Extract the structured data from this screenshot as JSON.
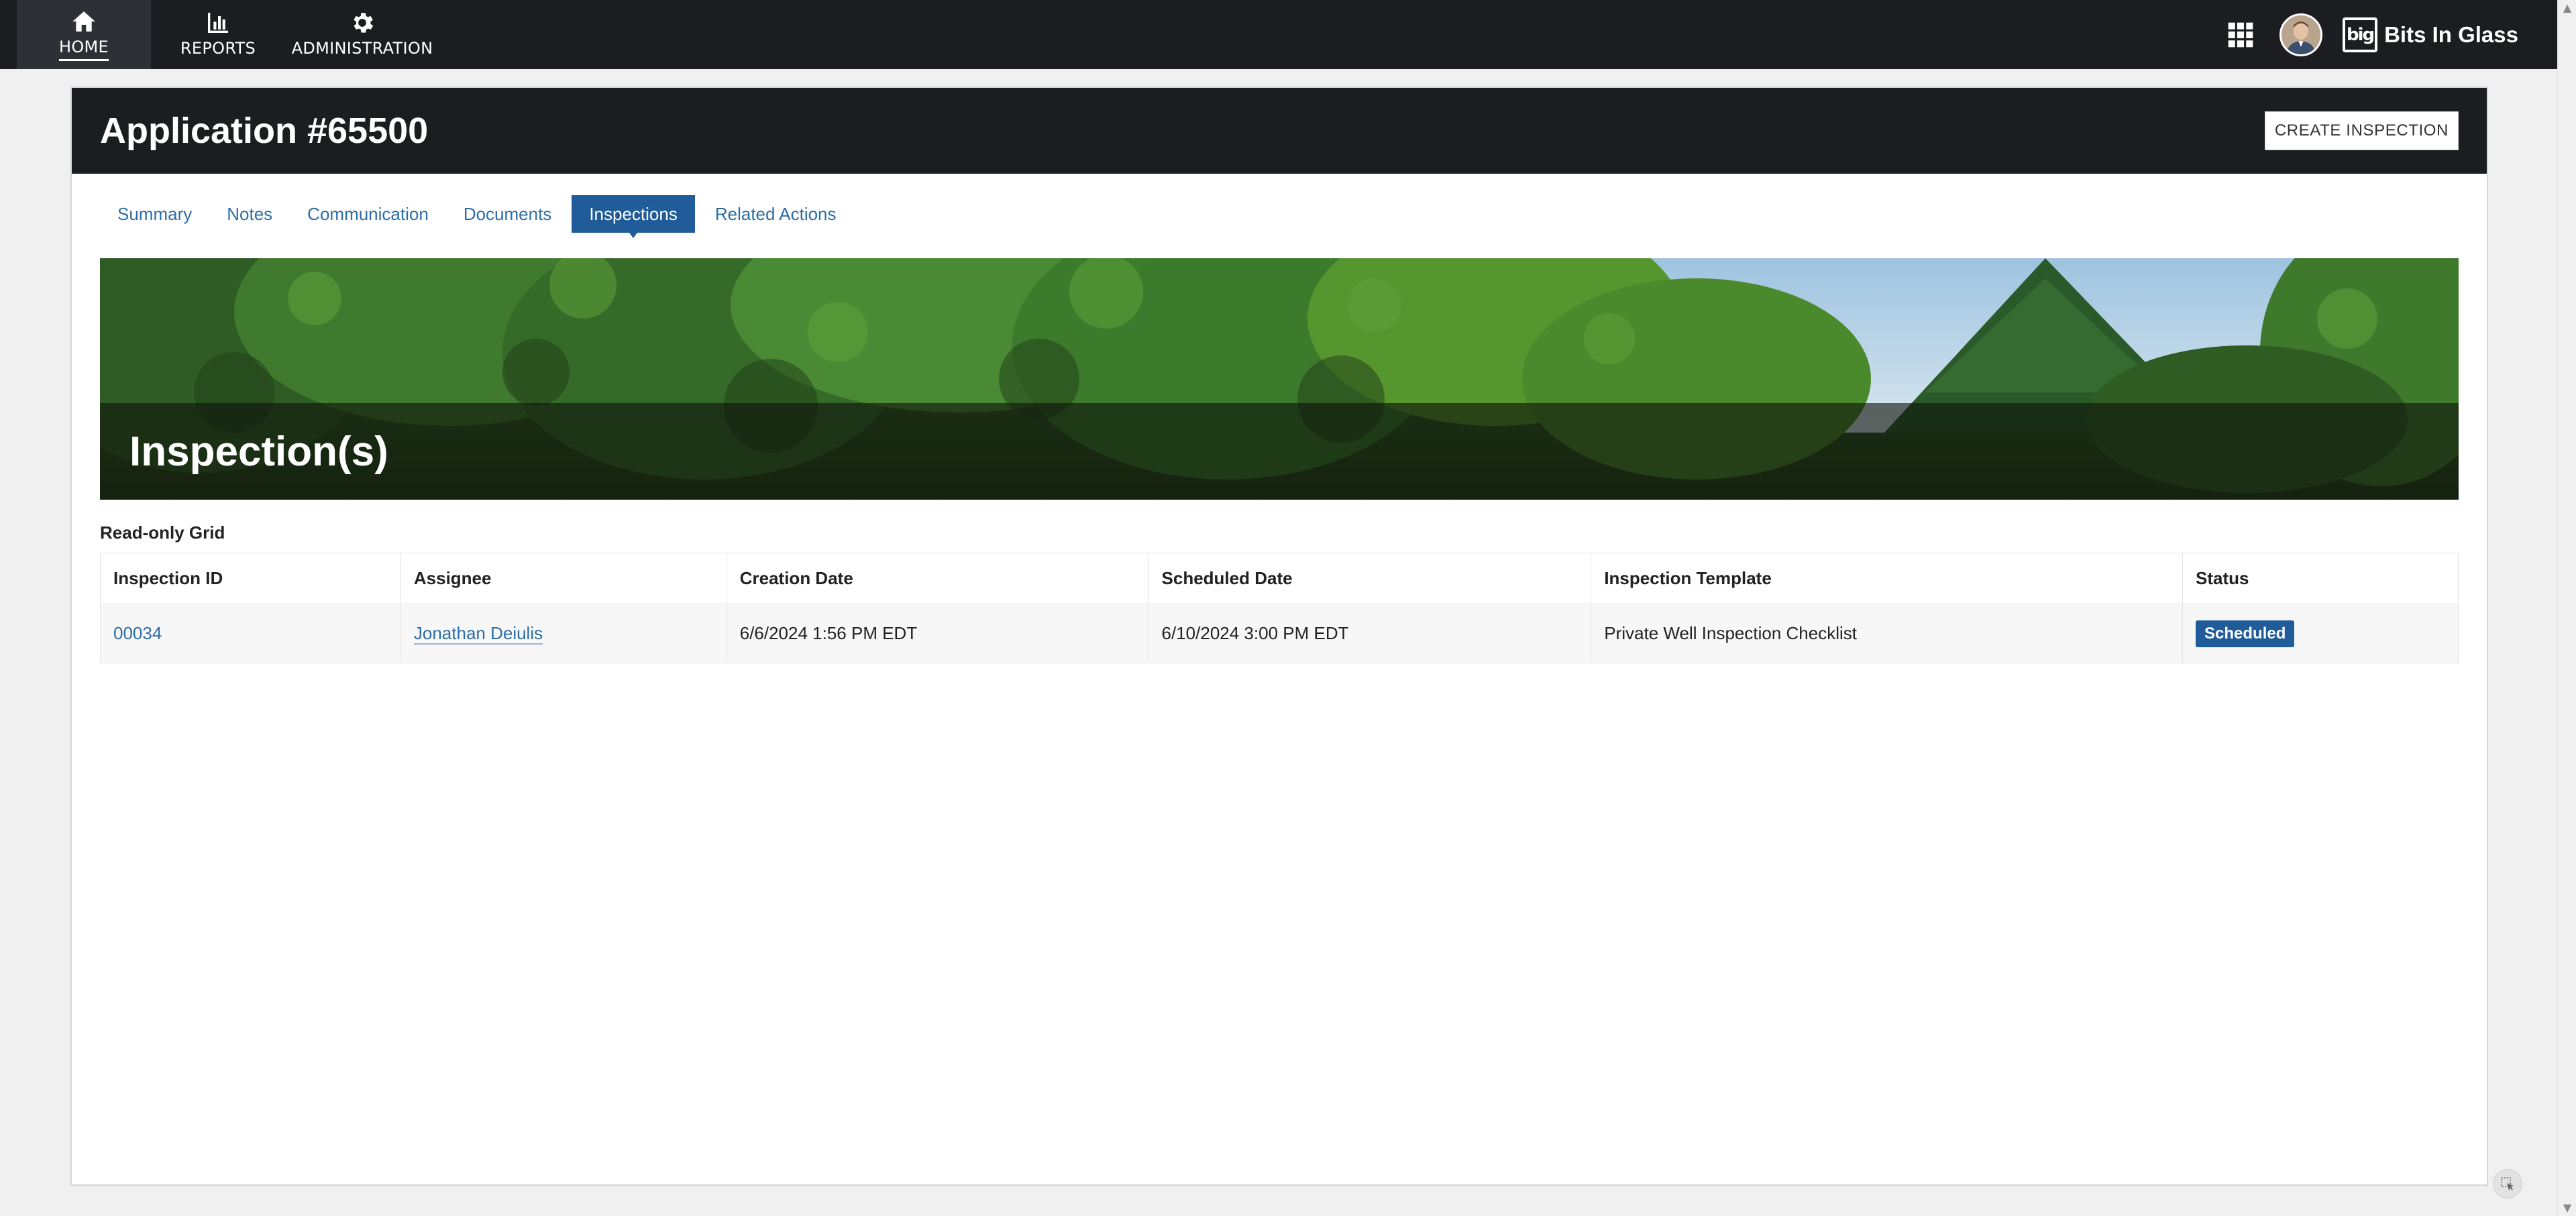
{
  "nav": {
    "items": [
      {
        "label": "HOME",
        "icon": "home-icon"
      },
      {
        "label": "REPORTS",
        "icon": "bar-chart-icon"
      },
      {
        "label": "ADMINISTRATION",
        "icon": "gear-icon"
      }
    ],
    "brand": "Bits In Glass",
    "brand_mark": "big"
  },
  "header": {
    "title": "Application #65500",
    "create_button": "CREATE INSPECTION"
  },
  "tabs": [
    {
      "label": "Summary"
    },
    {
      "label": "Notes"
    },
    {
      "label": "Communication"
    },
    {
      "label": "Documents"
    },
    {
      "label": "Inspections",
      "active": true
    },
    {
      "label": "Related Actions"
    }
  ],
  "banner": {
    "title": "Inspection(s)"
  },
  "grid": {
    "caption": "Read-only Grid",
    "columns": [
      "Inspection ID",
      "Assignee",
      "Creation Date",
      "Scheduled Date",
      "Inspection Template",
      "Status"
    ],
    "rows": [
      {
        "inspection_id": "00034",
        "assignee": "Jonathan Deiulis",
        "creation_date": "6/6/2024 1:56 PM EDT",
        "scheduled_date": "6/10/2024 3:00 PM EDT",
        "template": "Private Well Inspection Checklist",
        "status": "Scheduled"
      }
    ]
  },
  "colors": {
    "nav_bg": "#1b1d20",
    "accent": "#1f5c99",
    "link": "#2e6da4"
  }
}
